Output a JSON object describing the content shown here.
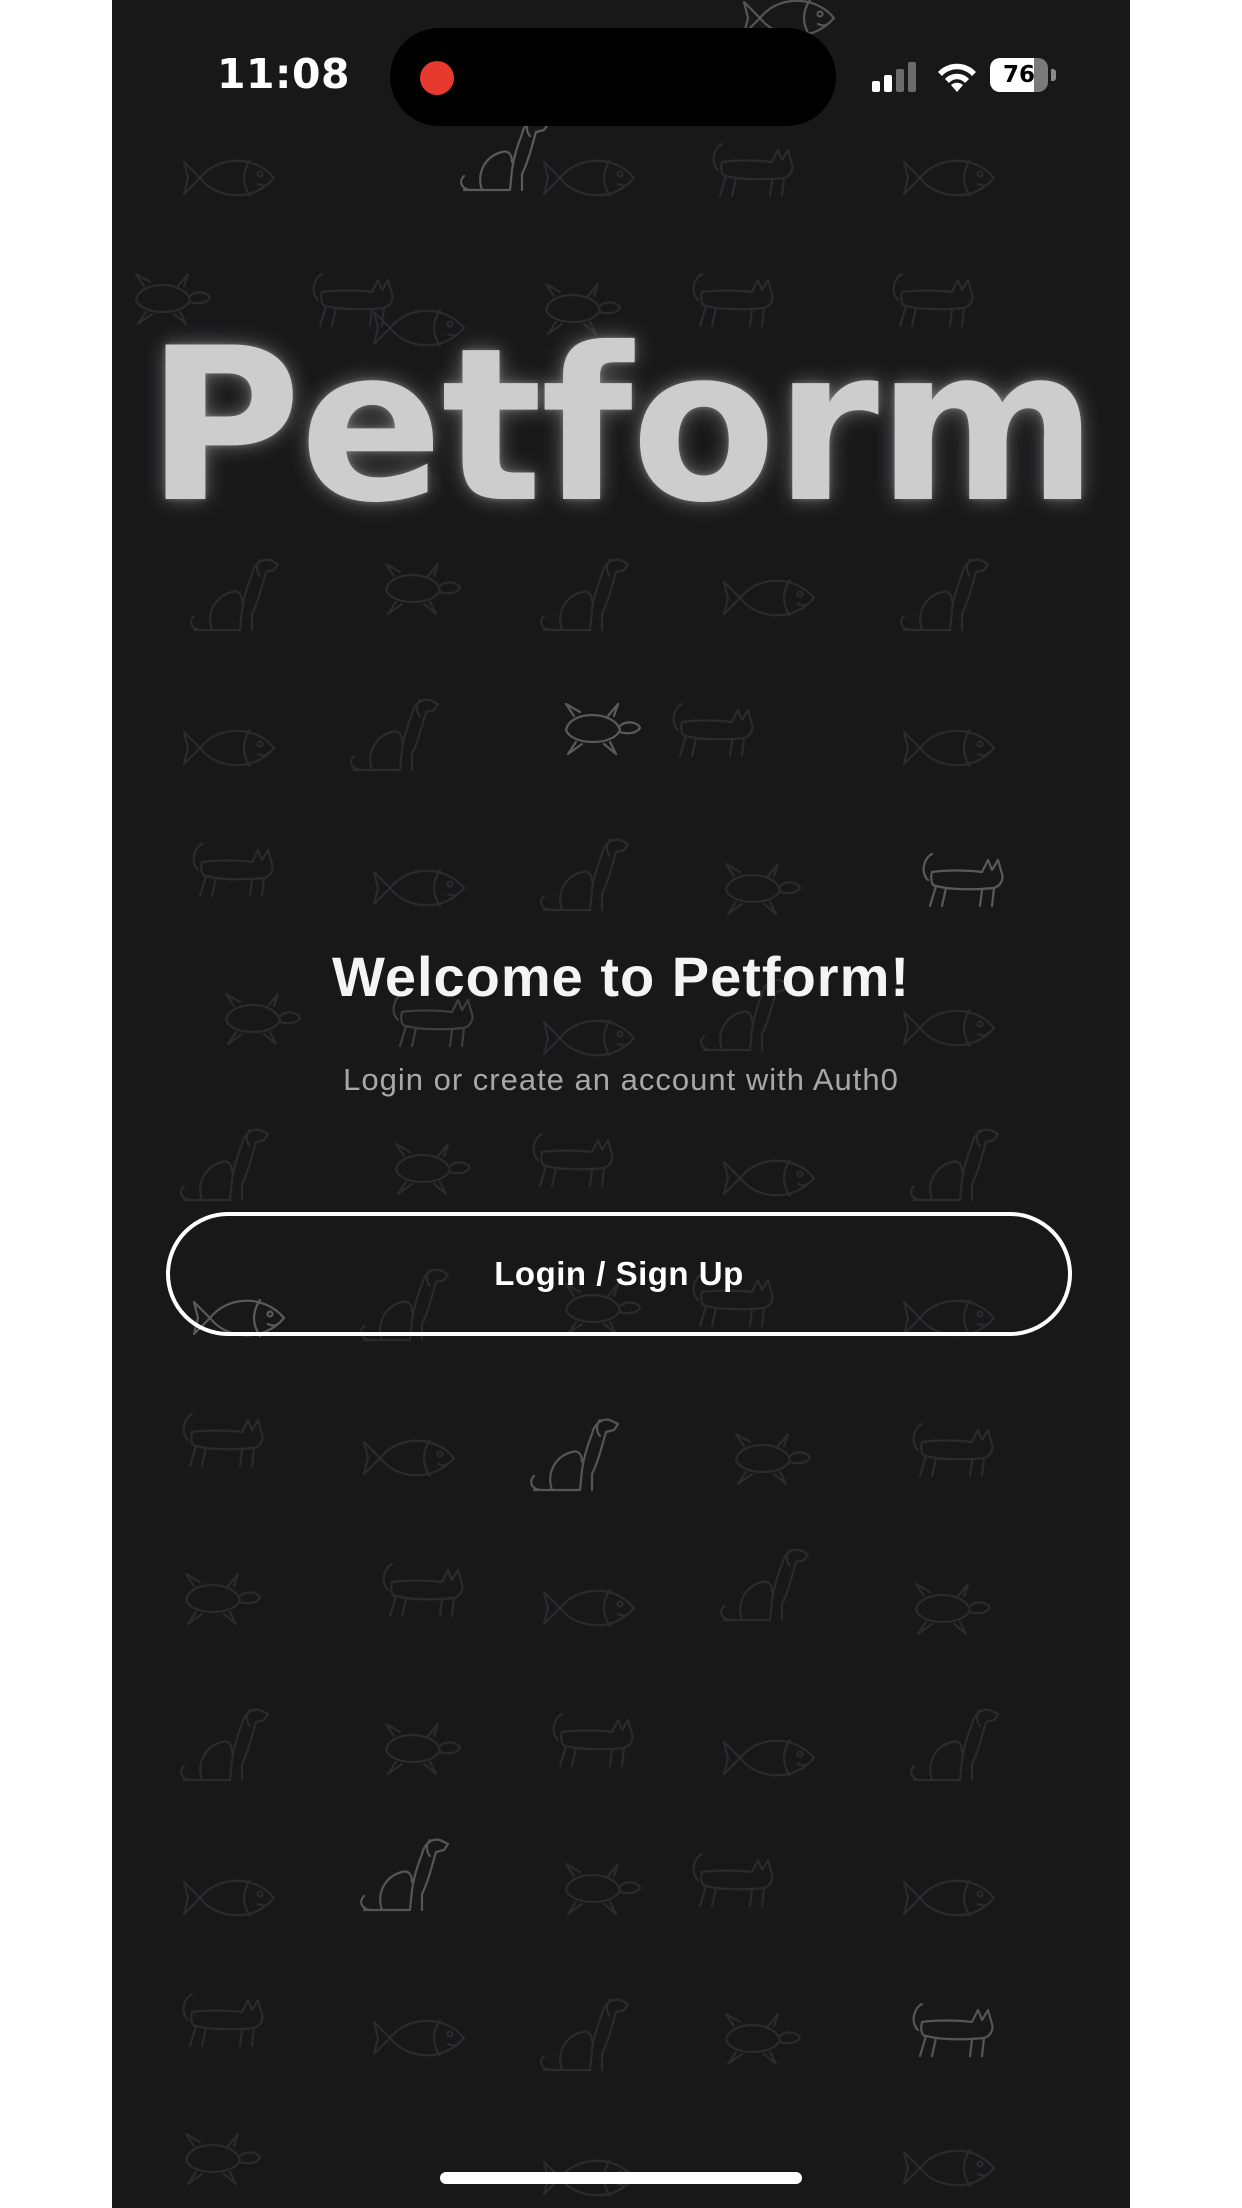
{
  "status_bar": {
    "time": "11:08",
    "battery_level": "76",
    "recording_dot_color": "#e7392e"
  },
  "logo": {
    "text": "Petform"
  },
  "welcome": {
    "title": "Welcome to Petform!",
    "subtitle": "Login or create an account with Auth0"
  },
  "auth": {
    "login_label": "Login / Sign Up"
  },
  "theme": {
    "background": "#181819",
    "logo_color": "#cdcdcd",
    "pattern_color": "#2e2e30",
    "pattern_highlight": "#5a5a5c"
  },
  "background_pattern_icons": [
    "fish-icon",
    "dog-icon",
    "cat-icon",
    "turtle-icon"
  ]
}
